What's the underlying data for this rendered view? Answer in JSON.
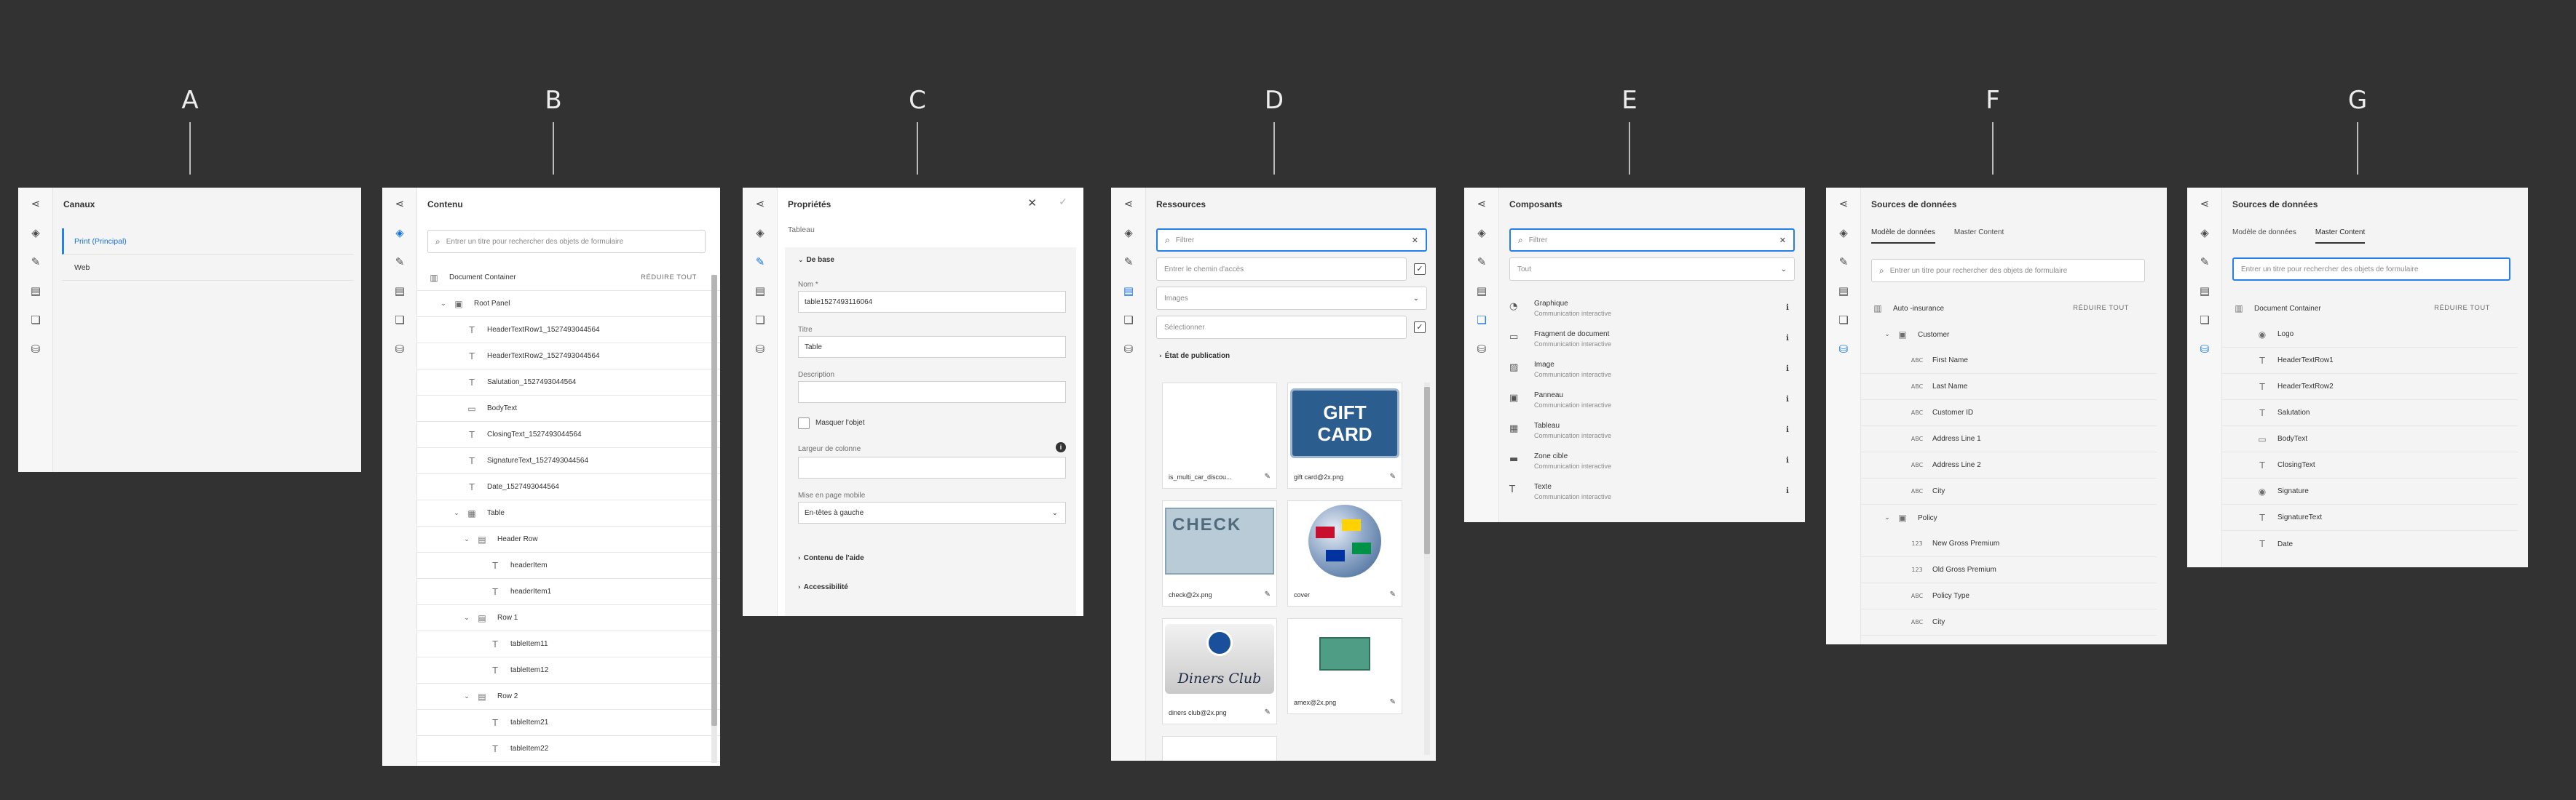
{
  "labels": {
    "a": "A",
    "b": "B",
    "c": "C",
    "d": "D",
    "e": "E",
    "f": "F",
    "g": "G"
  },
  "panelA": {
    "title": "Canaux",
    "items": [
      {
        "label": "Print (Principal)"
      },
      {
        "label": "Web"
      }
    ]
  },
  "panelB": {
    "title": "Contenu",
    "search_placeholder": "Entrer un titre pour rechercher des objets de formulaire",
    "reduce": "RÉDUIRE TOUT",
    "tree": [
      {
        "label": "Document Container",
        "icon": "doc-icon"
      },
      {
        "label": "Root Panel",
        "icon": "panel-icon"
      },
      {
        "label": "HeaderTextRow1_1527493044564",
        "icon": "text-icon"
      },
      {
        "label": "HeaderTextRow2_1527493044564",
        "icon": "text-icon"
      },
      {
        "label": "Salutation_1527493044564",
        "icon": "text-icon"
      },
      {
        "label": "BodyText",
        "icon": "image-icon"
      },
      {
        "label": "ClosingText_1527493044564",
        "icon": "text-icon"
      },
      {
        "label": "SignatureText_1527493044564",
        "icon": "text-icon"
      },
      {
        "label": "Date_1527493044564",
        "icon": "text-icon"
      },
      {
        "label": "Table",
        "icon": "table-icon"
      },
      {
        "label": "Header Row",
        "icon": "row-icon"
      },
      {
        "label": "headerItem",
        "icon": "text-icon"
      },
      {
        "label": "headerItem1",
        "icon": "text-icon"
      },
      {
        "label": "Row 1",
        "icon": "row-icon"
      },
      {
        "label": "tableItem11",
        "icon": "text-icon"
      },
      {
        "label": "tableItem12",
        "icon": "text-icon"
      },
      {
        "label": "Row 2",
        "icon": "row-icon"
      },
      {
        "label": "tableItem21",
        "icon": "text-icon"
      },
      {
        "label": "tableItem22",
        "icon": "text-icon"
      }
    ]
  },
  "panelC": {
    "title": "Propriétés",
    "subtitle": "Tableau",
    "section_basic": "De base",
    "name_label": "Nom *",
    "name_value": "table1527493116064",
    "title_label": "Titre",
    "title_value": "Table",
    "desc_label": "Description",
    "hide_label": "Masquer l'objet",
    "colwidth_label": "Largeur de colonne",
    "mobile_label": "Mise en page mobile",
    "mobile_value": "En-têtes à gauche",
    "help_section": "Contenu de l'aide",
    "access_section": "Accessibilité"
  },
  "panelD": {
    "title": "Ressources",
    "filter_placeholder": "Filtrer",
    "path_placeholder": "Entrer le chemin d'accès",
    "type_value": "Images",
    "select_placeholder": "Sélectionner",
    "publish_section": "État de publication",
    "assets": [
      {
        "caption": "is_multi_car_discou..."
      },
      {
        "caption": "gift card@2x.png",
        "thumb_text": "GIFT CARD"
      },
      {
        "caption": "check@2x.png",
        "thumb_text": "CHECK"
      },
      {
        "caption": "cover"
      },
      {
        "caption": "diners club@2x.png",
        "thumb_text": "Diners Club"
      },
      {
        "caption": "amex@2x.png"
      }
    ]
  },
  "panelE": {
    "title": "Composants",
    "filter_placeholder": "Filtrer",
    "group_value": "Tout",
    "components": [
      {
        "name": "Graphique",
        "group": "Communication interactive"
      },
      {
        "name": "Fragment de document",
        "group": "Communication interactive"
      },
      {
        "name": "Image",
        "group": "Communication interactive"
      },
      {
        "name": "Panneau",
        "group": "Communication interactive"
      },
      {
        "name": "Tableau",
        "group": "Communication interactive"
      },
      {
        "name": "Zone cible",
        "group": "Communication interactive"
      },
      {
        "name": "Texte",
        "group": "Communication interactive"
      }
    ]
  },
  "panelF": {
    "title": "Sources de données",
    "tab1": "Modèle de données",
    "tab2": "Master Content",
    "search_placeholder": "Entrer un titre pour rechercher des objets de formulaire",
    "reduce": "RÉDUIRE TOUT",
    "tree": [
      {
        "label": "Auto -insurance"
      },
      {
        "label": "Customer"
      },
      {
        "label": "First Name"
      },
      {
        "label": "Last Name"
      },
      {
        "label": "Customer ID"
      },
      {
        "label": "Address Line 1"
      },
      {
        "label": "Address Line 2"
      },
      {
        "label": "City"
      },
      {
        "label": "Policy"
      },
      {
        "label": "New Gross Premium"
      },
      {
        "label": "Old Gross Premium"
      },
      {
        "label": "Policy Type"
      },
      {
        "label": "City"
      }
    ]
  },
  "panelG": {
    "title": "Sources de données",
    "tab1": "Modèle de données",
    "tab2": "Master Content",
    "search_placeholder": "Entrer un titre pour rechercher des objets de formulaire",
    "reduce": "RÉDUIRE TOUT",
    "tree": [
      {
        "label": "Document Container"
      },
      {
        "label": "Logo"
      },
      {
        "label": "HeaderTextRow1"
      },
      {
        "label": "HeaderTextRow2"
      },
      {
        "label": "Salutation"
      },
      {
        "label": "BodyText"
      },
      {
        "label": "ClosingText"
      },
      {
        "label": "Signature"
      },
      {
        "label": "SignatureText"
      },
      {
        "label": "Date"
      }
    ]
  }
}
